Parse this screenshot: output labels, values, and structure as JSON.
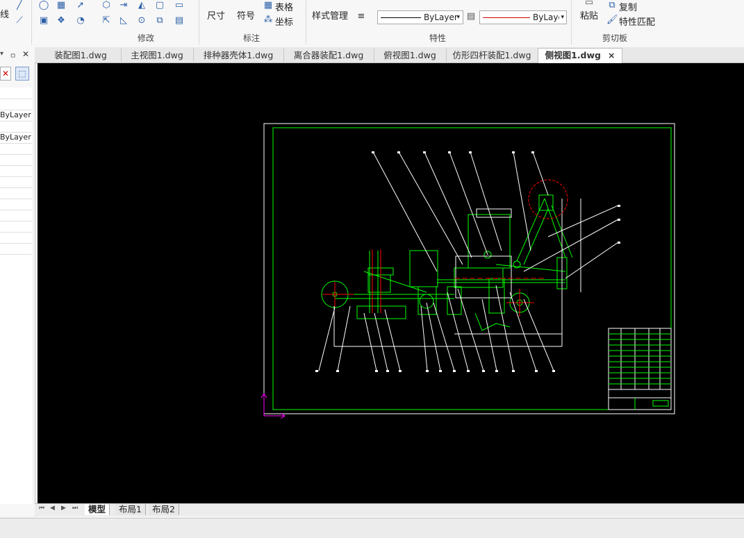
{
  "ribbon": {
    "partial_line_label": "线",
    "dimension_label": "尺寸",
    "symbol_label": "符号",
    "table_label": "表格",
    "coordinate_label": "坐标",
    "style_manager_label": "样式管理",
    "linetype_value": "ByLayer",
    "lineweight_value": "ByLayer",
    "paste_label": "粘贴",
    "copy_label": "复制",
    "match_properties_label": "特性匹配",
    "groups": {
      "modify": "修改",
      "annotation": "标注",
      "properties": "特性",
      "clipboard": "剪切板"
    }
  },
  "palette": {
    "rows": [
      "",
      "",
      "ByLayer",
      "",
      "ByLayer",
      "",
      "",
      "",
      "",
      "",
      "",
      "",
      "",
      "",
      ""
    ],
    "pin_glyph": "ㅁ",
    "close_glyph": "✕"
  },
  "tabs": [
    {
      "label": "装配图1.dwg",
      "active": false
    },
    {
      "label": "主视图1.dwg",
      "active": false
    },
    {
      "label": "排种器壳体1.dwg",
      "active": false
    },
    {
      "label": "离合器装配1.dwg",
      "active": false
    },
    {
      "label": "俯视图1.dwg",
      "active": false
    },
    {
      "label": "仿形四杆装配1.dwg",
      "active": false
    },
    {
      "label": "侧视图1.dwg",
      "active": true
    }
  ],
  "tab_close": "×",
  "layout_tabs": [
    {
      "label": "模型",
      "active": true
    },
    {
      "label": "布局1",
      "active": false
    },
    {
      "label": "布局2",
      "active": false
    }
  ],
  "colors": {
    "canvas_bg": "#000000",
    "drawing_green": "#00ff00",
    "drawing_white": "#ffffff",
    "drawing_red": "#ff0000",
    "ucs_magenta": "#ff00ff"
  }
}
